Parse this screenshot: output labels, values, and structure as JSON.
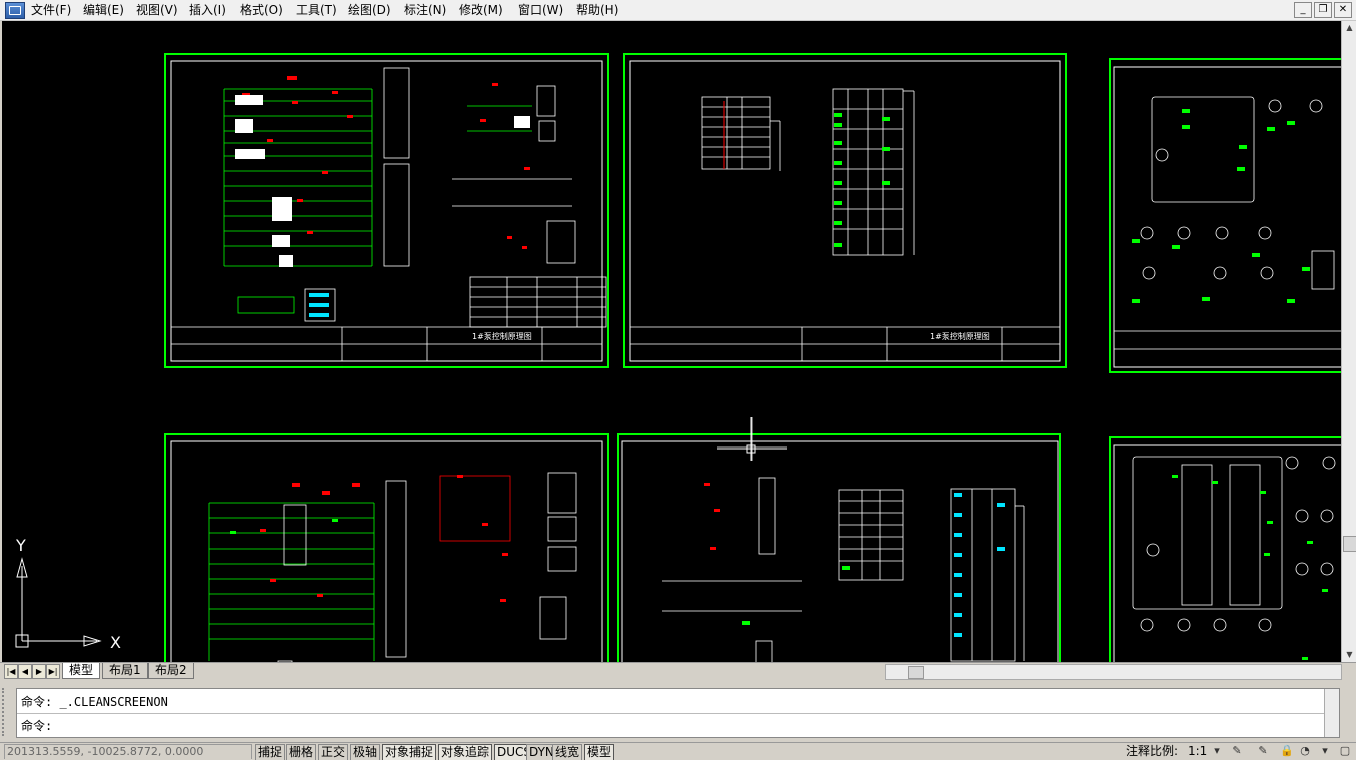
{
  "menu": [
    "文件(F)",
    "编辑(E)",
    "视图(V)",
    "插入(I)",
    "格式(O)",
    "工具(T)",
    "绘图(D)",
    "标注(N)",
    "修改(M)",
    "窗口(W)",
    "帮助(H)"
  ],
  "window_controls": {
    "minimize": "_",
    "restore": "❐",
    "close": "✕"
  },
  "drawing": {
    "sheet1_title": "1#泵控制原理图",
    "sheet2_title": "1#泵控制原理图",
    "ucs_y": "Y",
    "ucs_x": "X"
  },
  "tabs": {
    "model": "模型",
    "layout1": "布局1",
    "layout2": "布局2"
  },
  "command": {
    "history": "命令:  _.CLEANSCREENON",
    "prompt": "命令:",
    "value": ""
  },
  "status": {
    "coords": "201313.5559,  -10025.8772,  0.0000",
    "buttons": [
      "捕捉",
      "栅格",
      "正交",
      "极轴",
      "对象捕捉",
      "对象追踪",
      "DUCS",
      "DYN",
      "线宽",
      "模型"
    ],
    "active": [
      "对象捕捉",
      "对象追踪",
      "DUCS",
      "模型"
    ],
    "annotation_scale_label": "注释比例:",
    "annotation_scale_value": "1:1"
  },
  "colors": {
    "canvas": "#000000",
    "frame": "#00ff00",
    "red": "#ff0000",
    "white": "#ffffff",
    "cyan": "#00e5ff"
  }
}
